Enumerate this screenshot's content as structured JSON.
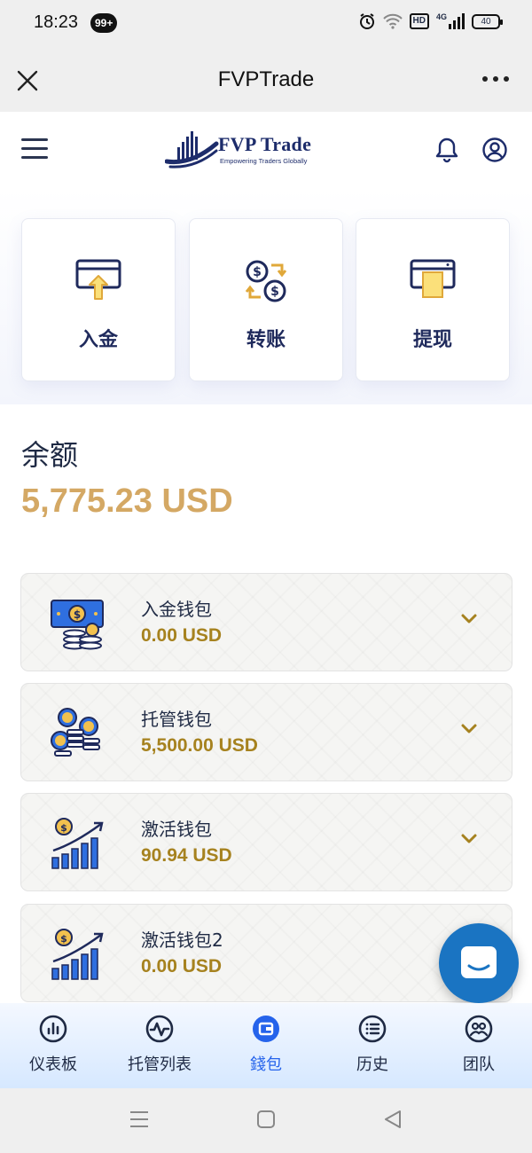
{
  "status_bar": {
    "time": "18:23",
    "badge": "99+",
    "network": "4G",
    "hd_label": "HD",
    "battery": "40"
  },
  "title_bar": {
    "title": "FVPTrade"
  },
  "header": {
    "logo_name": "FVP Trade",
    "logo_tagline": "Empowering Traders Globally"
  },
  "actions": [
    {
      "label": "入金",
      "icon": "deposit-icon"
    },
    {
      "label": "转账",
      "icon": "transfer-icon"
    },
    {
      "label": "提现",
      "icon": "withdraw-icon"
    }
  ],
  "balance": {
    "title": "余额",
    "value": "5,775.23 USD"
  },
  "wallets": [
    {
      "name": "入金钱包",
      "amount": "0.00 USD",
      "icon": "cash-icon"
    },
    {
      "name": "托管钱包",
      "amount": "5,500.00 USD",
      "icon": "coins-icon"
    },
    {
      "name": "激活钱包",
      "amount": "90.94 USD",
      "icon": "growth-icon"
    },
    {
      "name": "激活钱包2",
      "amount": "0.00 USD",
      "icon": "growth-icon"
    }
  ],
  "bottom_nav": [
    {
      "label": "仪表板",
      "icon": "dashboard-icon",
      "active": false
    },
    {
      "label": "托管列表",
      "icon": "activity-icon",
      "active": false
    },
    {
      "label": "錢包",
      "icon": "wallet-icon",
      "active": true
    },
    {
      "label": "历史",
      "icon": "list-icon",
      "active": false
    },
    {
      "label": "团队",
      "icon": "team-icon",
      "active": false
    }
  ],
  "colors": {
    "accent": "#d4a864",
    "amount": "#a6821f",
    "nav_active": "#2563eb",
    "brand": "#1d2c6b",
    "chat": "#1a74c2"
  }
}
